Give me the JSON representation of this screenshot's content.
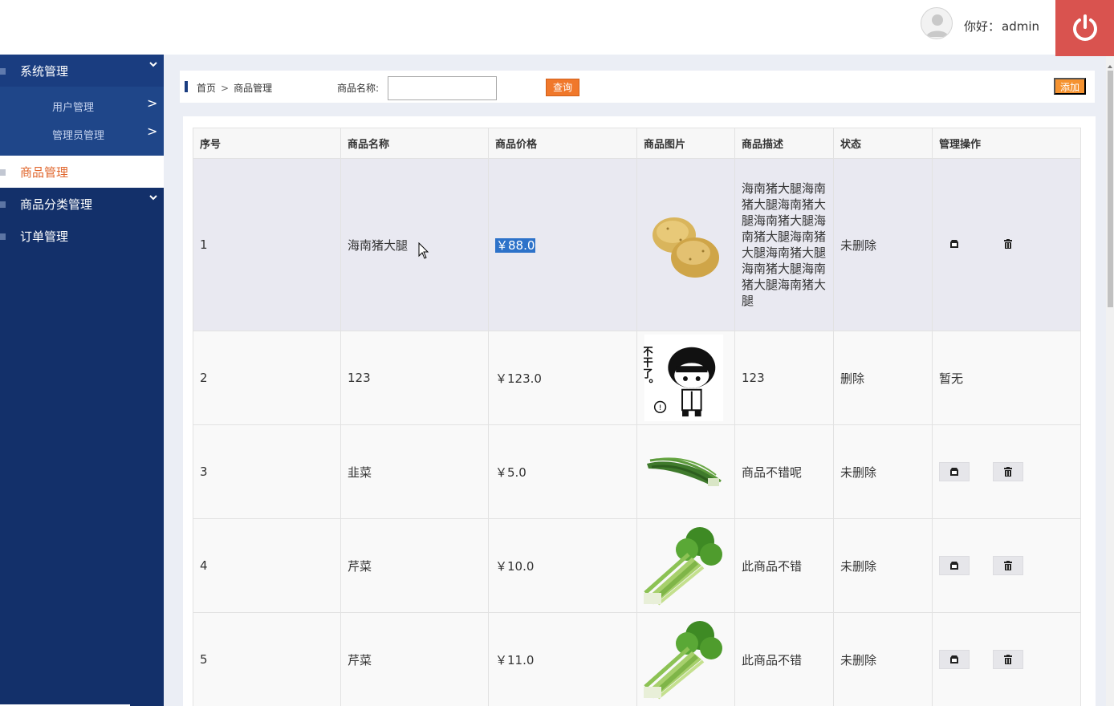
{
  "header": {
    "greeting_prefix": "你好：",
    "username": "admin",
    "avatar_icon": "user-avatar-icon",
    "logout_icon": "power-icon",
    "logout_color": "#d9534f"
  },
  "sidebar": {
    "background": "#13306a",
    "system": {
      "label": "系统管理"
    },
    "sub_items": [
      {
        "label": "用户管理",
        "arrow": ">"
      },
      {
        "label": "管理员管理",
        "arrow": ">"
      }
    ],
    "product": {
      "label": "商品管理"
    },
    "category": {
      "label": "商品分类管理"
    },
    "orders": {
      "label": "订单管理"
    }
  },
  "toolbar": {
    "breadcrumb_home": "首页",
    "breadcrumb_sep": ">",
    "breadcrumb_current": "商品管理",
    "search_label": "商品名称:",
    "search_value": "",
    "query_button": "查询",
    "add_button": "添加",
    "accent_color": "#f0782b"
  },
  "table": {
    "headers": [
      "序号",
      "商品名称",
      "商品价格",
      "商品图片",
      "商品描述",
      "状态",
      "管理操作"
    ],
    "rows": [
      {
        "no": "1",
        "name": "海南猪大腿",
        "price": "￥88.0",
        "image": "potato",
        "desc": "海南猪大腿海南猪大腿海南猪大腿海南猪大腿海南猪大腿海南猪大腿海南猪大腿海南猪大腿海南猪大腿海南猪大腿",
        "status": "未删除",
        "actions": "edit-delete"
      },
      {
        "no": "2",
        "name": "123",
        "price": "￥123.0",
        "image": "cartoon-boy",
        "desc": "123",
        "status": "删除",
        "actions_text": "暂无"
      },
      {
        "no": "3",
        "name": "韭菜",
        "price": "￥5.0",
        "image": "chives",
        "desc": "商品不错呢",
        "status": "未删除",
        "actions": "edit-delete"
      },
      {
        "no": "4",
        "name": "芹菜",
        "price": "￥10.0",
        "image": "celery",
        "desc": "此商品不错",
        "status": "未删除",
        "actions": "edit-delete"
      },
      {
        "no": "5",
        "name": "芹菜",
        "price": "￥11.0",
        "image": "celery",
        "desc": "此商品不错",
        "status": "未删除",
        "actions": "edit-delete"
      }
    ],
    "cartoon_text": "不干了。"
  }
}
